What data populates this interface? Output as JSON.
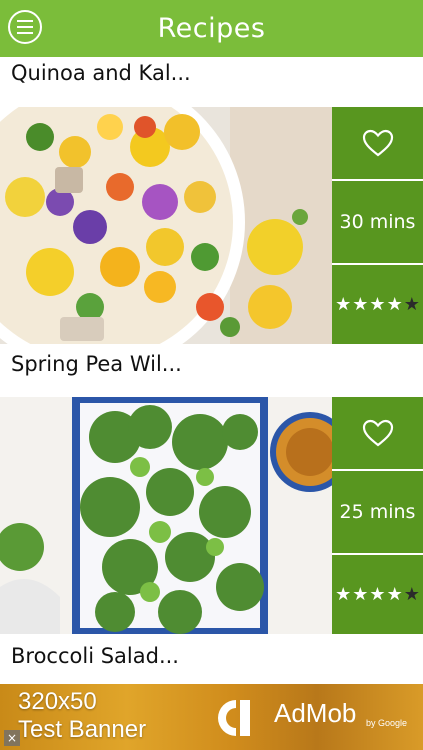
{
  "app": {
    "title": "Recipes",
    "header_color": "#7bbd3a",
    "accent_color": "#58961f"
  },
  "recipes": [
    {
      "title": "Quinoa and Kal...",
      "time": "30 mins",
      "rating": 4.5,
      "favorite": false
    },
    {
      "title": "Spring Pea Wil...",
      "time": "25 mins",
      "rating": 4,
      "favorite": false
    },
    {
      "title": "Broccoli Salad...",
      "time": "",
      "rating": null,
      "favorite": false
    }
  ],
  "icons": {
    "menu": "menu-icon",
    "favorite": "heart-outline-icon",
    "rating": "star-icon",
    "close": "close-icon"
  },
  "ad": {
    "text_line1": "320x50",
    "text_line2": "Test Banner",
    "brand": "AdMob",
    "brand_by": "by Google",
    "close": "×"
  }
}
